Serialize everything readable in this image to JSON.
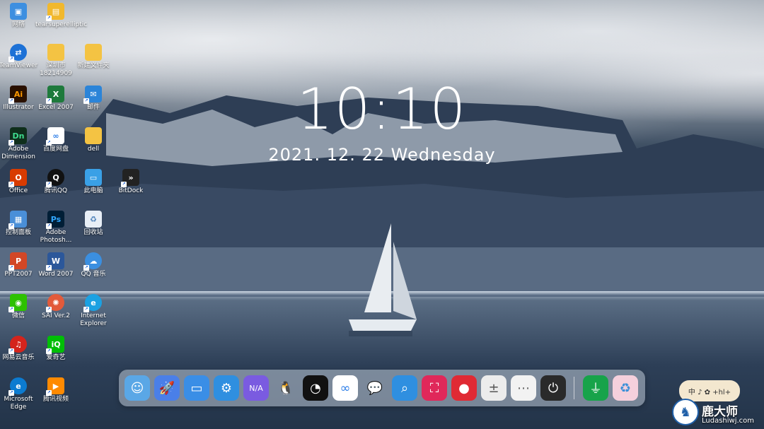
{
  "clock": {
    "time": "10:10",
    "date": "2021. 12. 22  Wednesday"
  },
  "desktop_icons": [
    {
      "label": "网络",
      "icon": "network-icon",
      "color": "#3d8fe0"
    },
    {
      "label": "tearsuperelliptic",
      "icon": "folder-app-icon",
      "color": "#f1b82d"
    },
    {
      "label": "TeamViewer",
      "icon": "teamviewer-icon",
      "color": "#1d71d6"
    },
    {
      "label": "深圳市 18214909",
      "icon": "folder-icon",
      "color": "#f4c343"
    },
    {
      "label": "新建文件夹",
      "icon": "folder-icon",
      "color": "#f4c343"
    },
    {
      "label": "Illustrator",
      "icon": "illustrator-icon",
      "color": "#2a1100"
    },
    {
      "label": "Excel 2007",
      "icon": "excel-icon",
      "color": "#1e7a3c"
    },
    {
      "label": "邮件",
      "icon": "mail-icon",
      "color": "#2b84d8"
    },
    {
      "label": "Adobe Dimension",
      "icon": "dimension-icon",
      "color": "#0f2f1c"
    },
    {
      "label": "百度网盘",
      "icon": "baidu-netdisk-icon",
      "color": "#ffffff"
    },
    {
      "label": "dell",
      "icon": "folder-icon",
      "color": "#f4c343"
    },
    {
      "label": "Office",
      "icon": "office-icon",
      "color": "#d83b01"
    },
    {
      "label": "腾讯QQ",
      "icon": "qq-icon",
      "color": "#111111"
    },
    {
      "label": "此电脑",
      "icon": "this-pc-icon",
      "color": "#3aa0e6"
    },
    {
      "label": "BitDock",
      "icon": "bitdock-icon",
      "color": "#222222"
    },
    {
      "label": "控制面板",
      "icon": "control-panel-icon",
      "color": "#4a8fd8"
    },
    {
      "label": "Adobe Photosh...",
      "icon": "photoshop-icon",
      "color": "#001e36"
    },
    {
      "label": "回收站",
      "icon": "recycle-bin-icon",
      "color": "#e8eef6"
    },
    {
      "label": "PPT2007",
      "icon": "powerpoint-icon",
      "color": "#d24726"
    },
    {
      "label": "Word 2007",
      "icon": "word-icon",
      "color": "#2b579a"
    },
    {
      "label": "QQ 音乐",
      "icon": "qq-music-icon",
      "color": "#3b8fe0"
    },
    {
      "label": "微信",
      "icon": "wechat-icon",
      "color": "#2dc100"
    },
    {
      "label": "SAI Ver.2",
      "icon": "sai-icon",
      "color": "#e25a3b"
    },
    {
      "label": "Internet Explorer",
      "icon": "internet-explorer-icon",
      "color": "#1ba1e2"
    },
    {
      "label": "网易云音乐",
      "icon": "netease-music-icon",
      "color": "#d4241c"
    },
    {
      "label": "爱奇艺",
      "icon": "iqiyi-icon",
      "color": "#00be06"
    },
    {
      "label": "Microsoft Edge",
      "icon": "edge-icon",
      "color": "#0c7bd0"
    },
    {
      "label": "腾讯视频",
      "icon": "tencent-video-icon",
      "color": "#ff8a00"
    }
  ],
  "dock": [
    {
      "icon": "finder-face-icon",
      "glyph": "☺",
      "bg": "#5aa7e6"
    },
    {
      "icon": "rocket-launcher-icon",
      "glyph": "🚀",
      "bg": "#4a7fe8"
    },
    {
      "icon": "app-store-icon",
      "glyph": "▭",
      "bg": "#3a8ee6"
    },
    {
      "icon": "settings-gear-icon",
      "glyph": "⚙",
      "bg": "#2f8fe0"
    },
    {
      "icon": "weather-cloud-icon",
      "glyph": "N/A",
      "bg": "#7a5be0"
    },
    {
      "icon": "qq-penguin-icon",
      "glyph": "🐧",
      "bg": "transparent"
    },
    {
      "icon": "pacman-icon",
      "glyph": "◔",
      "bg": "#111111"
    },
    {
      "icon": "baidu-netdisk-icon",
      "glyph": "∞",
      "bg": "#ffffff"
    },
    {
      "icon": "wechat-icon",
      "glyph": "💬",
      "bg": "transparent"
    },
    {
      "icon": "search-icon",
      "glyph": "⌕",
      "bg": "#2f8fe0"
    },
    {
      "icon": "screenshot-crop-icon",
      "glyph": "⛶",
      "bg": "#e0285a"
    },
    {
      "icon": "screen-record-icon",
      "glyph": "●",
      "bg": "#e02a34"
    },
    {
      "icon": "calculator-icon",
      "glyph": "±",
      "bg": "#ececec"
    },
    {
      "icon": "more-apps-icon",
      "glyph": "⋯",
      "bg": "#f2f2f2"
    },
    {
      "icon": "power-icon",
      "glyph": "⏻",
      "bg": "#2a2a2a"
    },
    {
      "icon": "usb-drive-icon",
      "glyph": "⏚",
      "bg": "#17a34a"
    },
    {
      "icon": "recycle-bin-icon",
      "glyph": "♻",
      "bg": "#f5d0dc"
    }
  ],
  "widget": {
    "text": "中 ♪ ✿ +hl+"
  },
  "watermark": {
    "brand": "鹿大师",
    "site": "Ludashiwj.com"
  }
}
